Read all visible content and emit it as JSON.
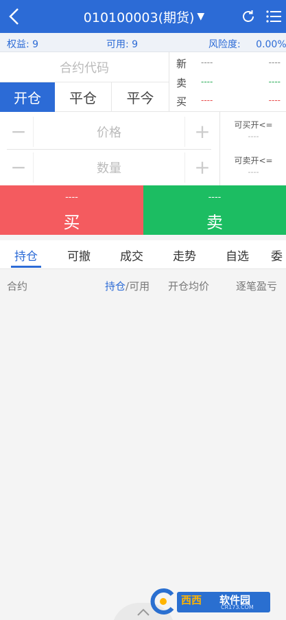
{
  "header": {
    "title": "010100003(期货)",
    "title_arrow": "▼"
  },
  "account": {
    "equity": "权益: 9",
    "available": "可用: 9",
    "risk_label": "风险度:",
    "risk_value": "0.00%"
  },
  "order": {
    "contract_placeholder": "合约代码",
    "action_tabs": [
      "开仓",
      "平仓",
      "平今"
    ],
    "price_placeholder": "价格",
    "quantity_placeholder": "数量",
    "minus": "−",
    "plus": "+"
  },
  "quote": {
    "latest_label": "新",
    "sell_label": "卖",
    "buy_label": "买",
    "placeholder": "----"
  },
  "availability": {
    "can_buy_open": "可买开<=",
    "can_sell_open": "可卖开<=",
    "placeholder": "----"
  },
  "trade": {
    "buy_price": "----",
    "buy_label": "买",
    "sell_price": "----",
    "sell_label": "卖"
  },
  "tabs": [
    "持仓",
    "可撤",
    "成交",
    "走势",
    "自选",
    "委"
  ],
  "table": {
    "col_contract": "合约",
    "col_position_hl": "持仓",
    "col_position_rest": "/可用",
    "col_avg_price": "开仓均价",
    "col_pl": "逐笔盈亏"
  },
  "watermark": {
    "brand1": "西西",
    "brand2": "软件园",
    "url": "CR173.COM"
  },
  "colors": {
    "primary": "#2c6bd6",
    "buy": "#f45b5f",
    "sell": "#1cbd62"
  }
}
